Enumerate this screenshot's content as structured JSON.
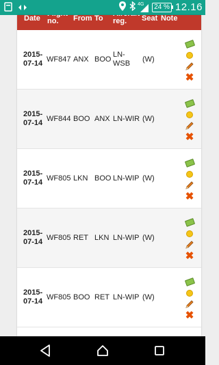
{
  "statusbar": {
    "battery": "24 %",
    "time": "12.16",
    "network": "4G",
    "icons": [
      "notification-icon",
      "vpn-arrows-icon",
      "location-icon",
      "bluetooth-icon",
      "signal-icon",
      "battery-icon"
    ]
  },
  "table": {
    "headers": {
      "date": "Date",
      "flight": "Flight\nno.",
      "from": "From",
      "to": "To",
      "reg": "Aircraft\nreg.",
      "seat": "Seat",
      "note": "Note"
    },
    "rows": [
      {
        "date": "2015-\n07-14",
        "flight": "WF847",
        "from": "ANX",
        "to": "BOO",
        "reg": "LN-\nWSB",
        "seat": "(W)"
      },
      {
        "date": "2015-\n07-14",
        "flight": "WF844",
        "from": "BOO",
        "to": "ANX",
        "reg": "LN-WIR",
        "seat": "(W)"
      },
      {
        "date": "2015-\n07-14",
        "flight": "WF805",
        "from": "LKN",
        "to": "BOO",
        "reg": "LN-WIP",
        "seat": "(W)"
      },
      {
        "date": "2015-\n07-14",
        "flight": "WF805",
        "from": "RET",
        "to": "LKN",
        "reg": "LN-WIP",
        "seat": "(W)"
      },
      {
        "date": "2015-\n07-14",
        "flight": "WF805",
        "from": "BOO",
        "to": "RET",
        "reg": "LN-WIP",
        "seat": "(W)"
      }
    ],
    "row_actions": [
      "money-icon",
      "coin-icon",
      "pencil-icon",
      "delete-x-icon"
    ]
  },
  "colors": {
    "statusbar": "#14a38d",
    "header": "#c0392b",
    "delete": "#e65100"
  }
}
